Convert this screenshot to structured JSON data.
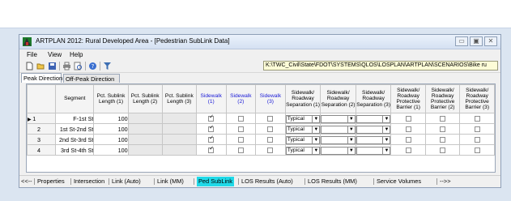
{
  "window": {
    "title": "ARTPLAN 2012: Rural Developed Area - [Pedestrian SubLink Data]",
    "controls": [
      "▭",
      "▣",
      "✕"
    ]
  },
  "menu": [
    "File",
    "View",
    "Help"
  ],
  "path": "K:\\TWC_Civil\\State\\FDOT\\SYSTEMS\\QLOS\\LOSPLAN\\ARTPLAN\\SCENARIOS\\Bike ru",
  "tabs": [
    "Peak Direction",
    "Off-Peak Direction"
  ],
  "grid": {
    "headers": [
      {
        "text": "Segment",
        "blue": false
      },
      {
        "text": "Pct. Sublink Length (1)",
        "blue": false
      },
      {
        "text": "Pct. Sublink Length (2)",
        "blue": false
      },
      {
        "text": "Pct. Sublink Length (3)",
        "blue": false
      },
      {
        "text": "Sidewalk (1)",
        "blue": true
      },
      {
        "text": "Sidewalk (2)",
        "blue": true
      },
      {
        "text": "Sidewalk (3)",
        "blue": true
      },
      {
        "text": "Sidewalk/ Roadway Separation (1)",
        "blue": false
      },
      {
        "text": "Sidewalk/ Roadway Separation (2)",
        "blue": false
      },
      {
        "text": "Sidewalk/ Roadway Separation (3)",
        "blue": false
      },
      {
        "text": "Sidewalk/ Roadway Protective Barrier (1)",
        "blue": false
      },
      {
        "text": "Sidewalk/ Roadway Protective Barrier (2)",
        "blue": false
      },
      {
        "text": "Sidewalk/ Roadway Protective Barrier (3)",
        "blue": false
      }
    ],
    "rows": [
      {
        "num": "1",
        "current": true,
        "segment": "F-1st St",
        "pct1": "100",
        "sw": [
          true,
          false,
          false
        ],
        "sep1": "Typical"
      },
      {
        "num": "2",
        "current": false,
        "segment": "1st St-2nd St",
        "pct1": "100",
        "sw": [
          true,
          false,
          false
        ],
        "sep1": "Typical"
      },
      {
        "num": "3",
        "current": false,
        "segment": "2nd St-3rd St",
        "pct1": "100",
        "sw": [
          true,
          false,
          false
        ],
        "sep1": "Typical"
      },
      {
        "num": "4",
        "current": false,
        "segment": "3rd St-4th St",
        "pct1": "100",
        "sw": [
          true,
          false,
          false
        ],
        "sep1": "Typical"
      }
    ]
  },
  "statusbar": {
    "items": [
      "<<--",
      "Properties",
      "Intersection",
      "Link (Auto)",
      "Link (MM)",
      "Ped SubLink",
      "LOS Results (Auto)",
      "LOS Results (MM)",
      "Service Volumes",
      "-->>"
    ],
    "active_index": 5,
    "active_color": "#20d9e8"
  }
}
